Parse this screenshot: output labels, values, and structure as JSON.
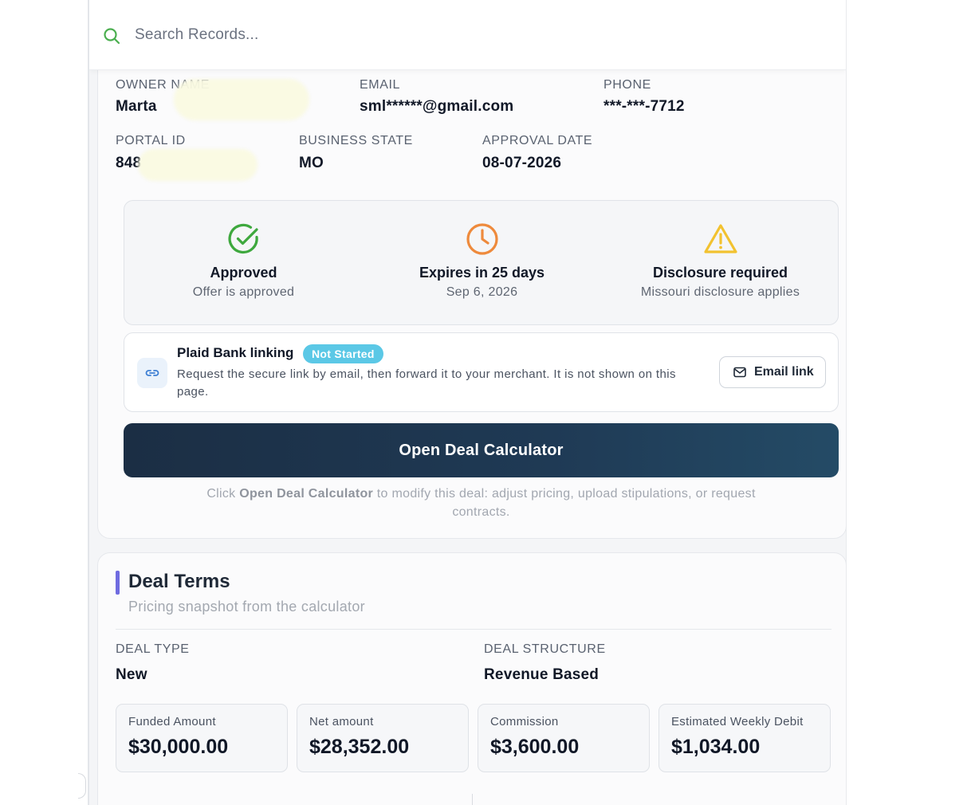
{
  "search": {
    "placeholder": "Search Records..."
  },
  "details": {
    "owner_name": {
      "label": "OWNER NAME",
      "value": "Marta"
    },
    "email": {
      "label": "EMAIL",
      "value": "sml******@gmail.com"
    },
    "phone": {
      "label": "PHONE",
      "value": "***-***-7712"
    },
    "portal_id": {
      "label": "PORTAL ID",
      "value": "848"
    },
    "business_state": {
      "label": "BUSINESS STATE",
      "value": "MO"
    },
    "approval_date": {
      "label": "APPROVAL DATE",
      "value": "08-07-2026"
    }
  },
  "status": [
    {
      "title": "Approved",
      "subtitle": "Offer is approved",
      "icon": "check-circle-icon",
      "color": "#3ea83e"
    },
    {
      "title": "Expires in 25 days",
      "subtitle": "Sep 6, 2026",
      "icon": "clock-icon",
      "color": "#ee8a3c"
    },
    {
      "title": "Disclosure required",
      "subtitle": "Missouri disclosure applies",
      "icon": "warning-triangle-icon",
      "color": "#f2c230"
    }
  ],
  "plaid": {
    "title": "Plaid Bank linking",
    "badge": "Not Started",
    "description": "Request the secure link by email, then forward it to your merchant. It is not shown on this page.",
    "button": "Email link",
    "icon": "link-icon"
  },
  "calculator": {
    "button": "Open Deal Calculator",
    "hint_prefix": "Click ",
    "hint_bold": "Open Deal Calculator",
    "hint_suffix": " to modify this deal: adjust pricing, upload stipulations, or request contracts."
  },
  "deal_terms": {
    "title": "Deal Terms",
    "subtitle": "Pricing snapshot from the calculator",
    "deal_type": {
      "label": "DEAL TYPE",
      "value": "New"
    },
    "deal_structure": {
      "label": "DEAL STRUCTURE",
      "value": "Revenue Based"
    },
    "metrics": [
      {
        "label": "Funded Amount",
        "value": "$30,000.00"
      },
      {
        "label": "Net amount",
        "value": "$28,352.00"
      },
      {
        "label": "Commission",
        "value": "$3,600.00"
      },
      {
        "label": "Estimated Weekly Debit",
        "value": "$1,034.00"
      }
    ]
  },
  "colors": {
    "accent": "#6f6be0",
    "primary_button": "#1f3a55",
    "search_icon": "#4caf50",
    "badge": "#5bc8e6"
  }
}
